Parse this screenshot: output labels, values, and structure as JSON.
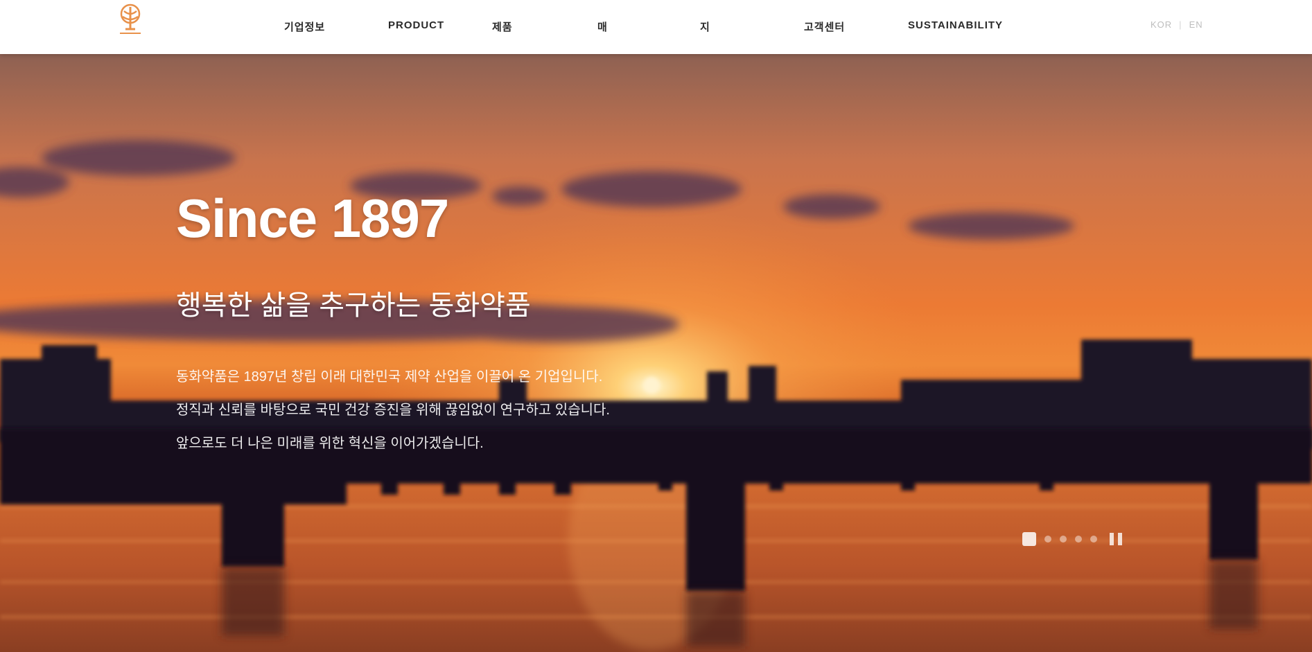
{
  "brand": {
    "logo_text": "",
    "accent": "#e8914a"
  },
  "nav": {
    "items": [
      {
        "label": "기업정보"
      },
      {
        "label": "PRODUCT"
      },
      {
        "label": "제품"
      },
      {
        "label": "매"
      },
      {
        "label": "지"
      },
      {
        "label": "고객센터"
      },
      {
        "label": "SUSTAINABILITY"
      }
    ],
    "lang": {
      "primary": "KOR",
      "secondary": "EN"
    }
  },
  "hero": {
    "title": "Since 1897",
    "subtitle": "행복한 삶을 추구하는 동화약품",
    "body_lines": [
      "동화약품은 1897년 창립 이래 대한민국 제약 산업을 이끌어 온 기업입니다.",
      "정직과 신뢰를 바탕으로 국민 건강 증진을 위해 끊임없이 연구하고 있습니다.",
      "앞으로도 더 나은 미래를 위한 혁신을 이어가겠습니다."
    ],
    "colors": {
      "sky_top": "#9b6a5c",
      "sky_mid": "#e46a2a",
      "sun": "#fff0c4",
      "water": "#c15a2a",
      "silhouette": "#160f1e"
    }
  },
  "slider": {
    "slide_count": 5,
    "active_index": 0
  }
}
